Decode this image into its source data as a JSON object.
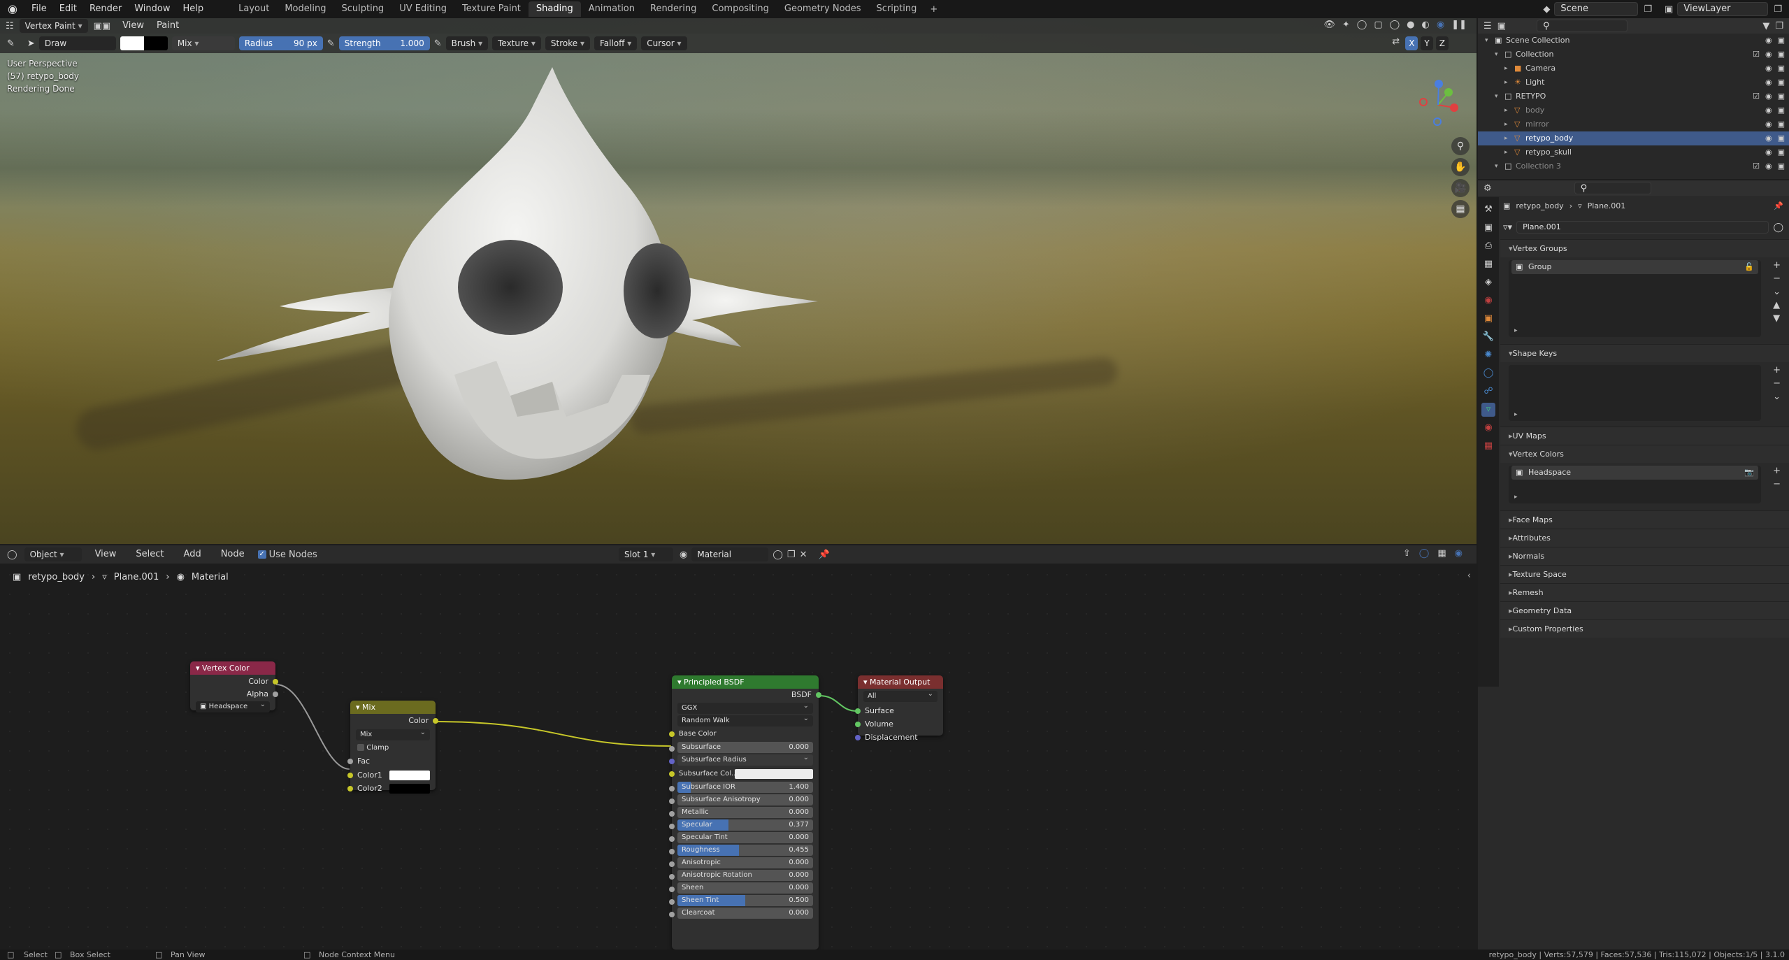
{
  "topbar": {
    "menus": [
      "File",
      "Edit",
      "Render",
      "Window",
      "Help"
    ],
    "workspaces": [
      "Layout",
      "Modeling",
      "Sculpting",
      "UV Editing",
      "Texture Paint",
      "Shading",
      "Animation",
      "Rendering",
      "Compositing",
      "Geometry Nodes",
      "Scripting"
    ],
    "active_workspace": "Shading",
    "scene": "Scene",
    "view_layer": "ViewLayer"
  },
  "viewport": {
    "mode": "Vertex Paint",
    "menus": [
      "View",
      "Paint"
    ],
    "tool": {
      "brush_name": "Draw",
      "blend": "Mix",
      "radius_label": "Radius",
      "radius_value": "90 px",
      "strength_label": "Strength",
      "strength_value": "1.000",
      "menus": [
        "Brush",
        "Texture",
        "Stroke",
        "Falloff",
        "Cursor"
      ]
    },
    "axes": [
      "X",
      "Y",
      "Z"
    ],
    "info": [
      "User Perspective",
      "(57) retypo_body",
      "Rendering Done"
    ]
  },
  "node_editor": {
    "editor_type": "Object",
    "menus": [
      "View",
      "Select",
      "Add",
      "Node"
    ],
    "use_nodes_label": "Use Nodes",
    "slot": "Slot 1",
    "material": "Material",
    "breadcrumb": [
      "retypo_body",
      "Plane.001",
      "Material"
    ],
    "nodes": {
      "vertex_color": {
        "title": "Vertex Color",
        "outputs": [
          "Color",
          "Alpha"
        ],
        "layer": "Headspace"
      },
      "mix": {
        "title": "Mix",
        "output": "Color",
        "blend": "Mix",
        "clamp": "Clamp",
        "inputs": [
          "Fac",
          "Color1",
          "Color2"
        ]
      },
      "bsdf": {
        "title": "Principled BSDF",
        "output": "BSDF",
        "distribution": "GGX",
        "subsurface_method": "Random Walk",
        "base_color": "Base Color",
        "subsurface_radius": "Subsurface Radius",
        "subsurface_color": "Subsurface Col...",
        "fields": [
          {
            "label": "Subsurface",
            "value": "0.000",
            "fill": 0
          },
          {
            "label": "Subsurface IOR",
            "value": "1.400",
            "fill": 0.1
          },
          {
            "label": "Subsurface Anisotropy",
            "value": "0.000",
            "fill": 0
          },
          {
            "label": "Metallic",
            "value": "0.000",
            "fill": 0
          },
          {
            "label": "Specular",
            "value": "0.377",
            "fill": 0.377
          },
          {
            "label": "Specular Tint",
            "value": "0.000",
            "fill": 0
          },
          {
            "label": "Roughness",
            "value": "0.455",
            "fill": 0.455
          },
          {
            "label": "Anisotropic",
            "value": "0.000",
            "fill": 0
          },
          {
            "label": "Anisotropic Rotation",
            "value": "0.000",
            "fill": 0
          },
          {
            "label": "Sheen",
            "value": "0.000",
            "fill": 0
          },
          {
            "label": "Sheen Tint",
            "value": "0.500",
            "fill": 0.5
          },
          {
            "label": "Clearcoat",
            "value": "0.000",
            "fill": 0
          }
        ]
      },
      "output": {
        "title": "Material Output",
        "target": "All",
        "inputs": [
          "Surface",
          "Volume",
          "Displacement"
        ]
      }
    }
  },
  "outliner": {
    "rows": [
      {
        "label": "Scene Collection",
        "indent": 0,
        "icon": "scene-collection-icon"
      },
      {
        "label": "Collection",
        "indent": 1,
        "icon": "collection-icon"
      },
      {
        "label": "Camera",
        "indent": 2,
        "icon": "camera-icon"
      },
      {
        "label": "Light",
        "indent": 2,
        "icon": "light-icon"
      },
      {
        "label": "RETYPO",
        "indent": 1,
        "icon": "collection-icon"
      },
      {
        "label": "body",
        "indent": 2,
        "icon": "mesh-icon"
      },
      {
        "label": "mirror",
        "indent": 2,
        "icon": "mesh-icon"
      },
      {
        "label": "retypo_body",
        "indent": 2,
        "icon": "mesh-icon",
        "selected": true
      },
      {
        "label": "retypo_skull",
        "indent": 2,
        "icon": "mesh-icon"
      },
      {
        "label": "Collection 3",
        "indent": 1,
        "icon": "collection-icon"
      }
    ]
  },
  "properties": {
    "object": "retypo_body",
    "data": "Plane.001",
    "mesh_name": "Plane.001",
    "panels": {
      "vertex_groups": "Vertex Groups",
      "group_item": "Group",
      "shape_keys": "Shape Keys",
      "uv_maps": "UV Maps",
      "vertex_colors": "Vertex Colors",
      "vertex_color_item": "Headspace",
      "closed": [
        "Face Maps",
        "Attributes",
        "Normals",
        "Texture Space",
        "Remesh",
        "Geometry Data",
        "Custom Properties"
      ]
    }
  },
  "statusbar": {
    "left": [
      "Select",
      "Box Select",
      "Pan View",
      "Node Context Menu"
    ],
    "right": "retypo_body | Verts:57,579 | Faces:57,536 | Tris:115,072 | Objects:1/5 | 3.1.0"
  },
  "colors": {
    "accent": "#4772b3",
    "vertex_color_header": "#8a2848",
    "mix_header": "#6b6b1f",
    "bsdf_header": "#2f7a2f",
    "output_header": "#7a2f2f",
    "wire": "#c7c729"
  }
}
